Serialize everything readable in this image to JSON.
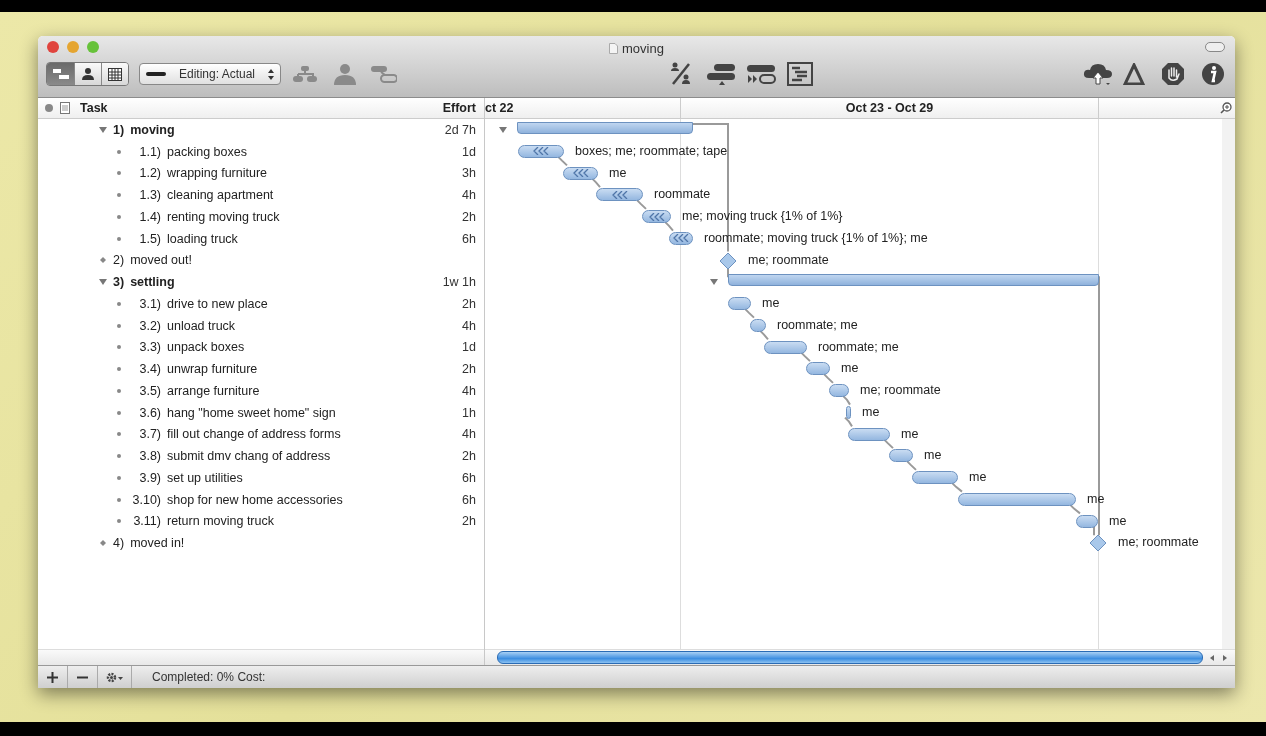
{
  "window": {
    "title": "moving"
  },
  "toolbar": {
    "view_buttons": [
      {
        "kind": "gantt",
        "selected": true
      },
      {
        "kind": "resource",
        "selected": false
      },
      {
        "kind": "calendar",
        "selected": false
      }
    ],
    "editing_popup": {
      "label": "Editing: Actual"
    }
  },
  "outline": {
    "columns": [
      "Task",
      "Effort"
    ],
    "tasks": [
      {
        "number": "1)",
        "name": "moving",
        "effort": "2d 7h",
        "kind": "group",
        "expanded": true,
        "children": [
          {
            "number": "1.1)",
            "name": "packing boxes",
            "effort": "1d",
            "kind": "task",
            "marked": true,
            "assignments": "boxes; me; roommate; tape"
          },
          {
            "number": "1.2)",
            "name": "wrapping furniture",
            "effort": "3h",
            "kind": "task",
            "marked": true,
            "assignments": "me"
          },
          {
            "number": "1.3)",
            "name": "cleaning apartment",
            "effort": "4h",
            "kind": "task",
            "marked": true,
            "assignments": "roommate"
          },
          {
            "number": "1.4)",
            "name": "renting moving truck",
            "effort": "2h",
            "kind": "task",
            "marked": true,
            "assignments": "me; moving truck {1% of 1%}"
          },
          {
            "number": "1.5)",
            "name": "loading truck",
            "effort": "6h",
            "kind": "task",
            "marked": true,
            "assignments": "roommate; moving truck {1% of 1%}; me"
          }
        ]
      },
      {
        "number": "2)",
        "name": "moved out!",
        "kind": "milestone",
        "assignments": "me; roommate"
      },
      {
        "number": "3)",
        "name": "settling",
        "effort": "1w 1h",
        "kind": "group",
        "expanded": true,
        "children": [
          {
            "number": "3.1)",
            "name": "drive to new place",
            "effort": "2h",
            "kind": "task",
            "marked": false,
            "assignments": "me"
          },
          {
            "number": "3.2)",
            "name": "unload truck",
            "effort": "4h",
            "kind": "task",
            "marked": false,
            "assignments": "roommate; me"
          },
          {
            "number": "3.3)",
            "name": "unpack boxes",
            "effort": "1d",
            "kind": "task",
            "marked": false,
            "assignments": "roommate; me"
          },
          {
            "number": "3.4)",
            "name": "unwrap furniture",
            "effort": "2h",
            "kind": "task",
            "marked": false,
            "assignments": "me"
          },
          {
            "number": "3.5)",
            "name": "arrange furniture",
            "effort": "4h",
            "kind": "task",
            "marked": false,
            "assignments": "me; roommate"
          },
          {
            "number": "3.6)",
            "name": "hang \"home sweet home\" sign",
            "effort": "1h",
            "kind": "task",
            "marked": false,
            "assignments": "me"
          },
          {
            "number": "3.7)",
            "name": "fill out change of address forms",
            "effort": "4h",
            "kind": "task",
            "marked": false,
            "assignments": "me"
          },
          {
            "number": "3.8)",
            "name": "submit dmv chang of address",
            "effort": "2h",
            "kind": "task",
            "marked": false,
            "assignments": "me"
          },
          {
            "number": "3.9)",
            "name": "set up utilities",
            "effort": "6h",
            "kind": "task",
            "marked": false,
            "assignments": "me"
          },
          {
            "number": "3.10)",
            "name": "shop for new home accessories",
            "effort": "6h",
            "kind": "task",
            "marked": false,
            "assignments": "me"
          },
          {
            "number": "3.11)",
            "name": "return moving truck",
            "effort": "2h",
            "kind": "task",
            "marked": false,
            "assignments": "me"
          }
        ]
      },
      {
        "number": "4)",
        "name": "moved in!",
        "kind": "milestone",
        "assignments": "me; roommate"
      }
    ]
  },
  "timeline": {
    "headers": [
      "ct 22",
      "Oct 23 - Oct 29"
    ]
  },
  "status_bar": {
    "text": "Completed: 0% Cost:"
  }
}
